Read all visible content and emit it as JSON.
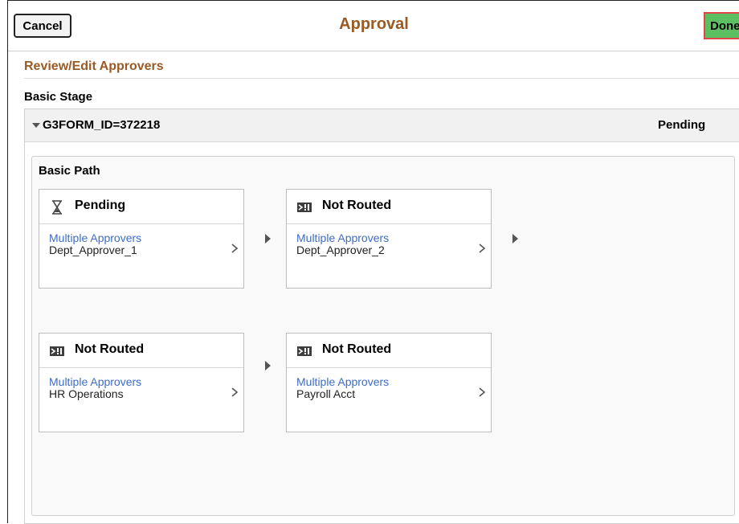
{
  "header": {
    "cancel_label": "Cancel",
    "title": "Approval",
    "done_label": "Done"
  },
  "section": {
    "title": "Review/Edit Approvers"
  },
  "stage": {
    "label": "Basic Stage",
    "id": "G3FORM_ID=372218",
    "status": "Pending",
    "path": {
      "label": "Basic Path",
      "steps": [
        {
          "status": "Pending",
          "icon": "hourglass-icon",
          "approver_type": "Multiple Approvers",
          "approver": "Dept_Approver_1"
        },
        {
          "status": "Not Routed",
          "icon": "not-routed-icon",
          "approver_type": "Multiple Approvers",
          "approver": "Dept_Approver_2"
        },
        {
          "status": "Not Routed",
          "icon": "not-routed-icon",
          "approver_type": "Multiple Approvers",
          "approver": "HR Operations"
        },
        {
          "status": "Not Routed",
          "icon": "not-routed-icon",
          "approver_type": "Multiple Approvers",
          "approver": "Payroll Acct"
        }
      ]
    }
  },
  "colors": {
    "title_brown": "#9a5a24",
    "link_blue": "#3f6cc4",
    "done_green": "#5cc063",
    "done_border": "#e0454c"
  }
}
